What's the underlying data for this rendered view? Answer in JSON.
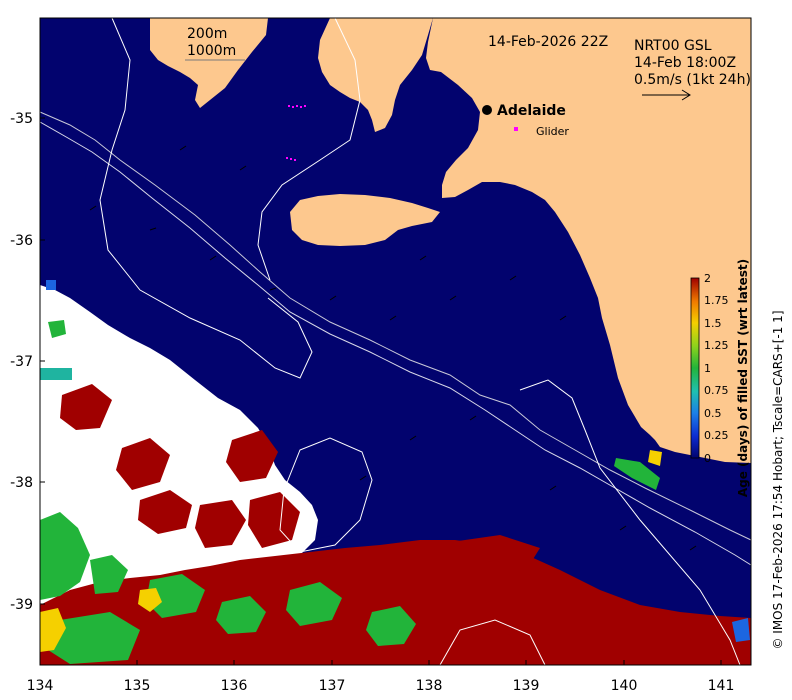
{
  "map": {
    "timestamp": "14-Feb-2026 22Z",
    "isobath_labels": [
      "200m",
      "1000m"
    ],
    "current_legend": {
      "product": "NRT00 GSL",
      "time": "14-Feb 18:00Z",
      "scale": "0.5m/s (1kt 24h)"
    },
    "city": "Adelaide",
    "glider_label": "Glider",
    "x_ticks": [
      "134",
      "135",
      "136",
      "137",
      "138",
      "139",
      "140",
      "141"
    ],
    "y_ticks": [
      "-35",
      "-36",
      "-37",
      "-38",
      "-39"
    ],
    "credit": "© IMOS 17-Feb-2026 17:54 Hobart; Tscale=CARS+[-1 1]",
    "colors": {
      "ocean": "#02036e",
      "land": "#fdc88e",
      "old": "#a00000",
      "cloud": "#ffffff"
    }
  },
  "colorbar": {
    "label": "Age (days) of filled SST (wrt latest)",
    "ticks": [
      "2",
      "1.75",
      "1.5",
      "1.25",
      "1",
      "0.75",
      "0.5",
      "0.25",
      "0"
    ]
  }
}
